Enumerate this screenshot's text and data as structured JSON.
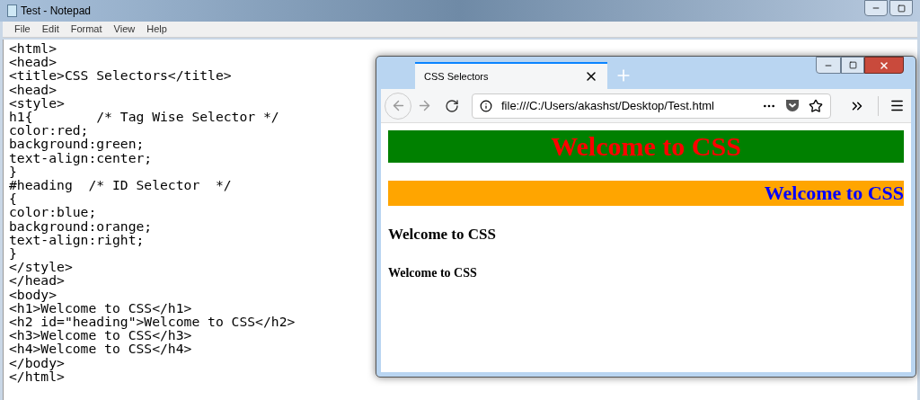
{
  "notepad": {
    "title": "Test - Notepad",
    "menu": [
      "File",
      "Edit",
      "Format",
      "View",
      "Help"
    ],
    "lines": [
      "<html>",
      "<head>",
      "<title>CSS Selectors</title>",
      "<head>",
      "<style>",
      "h1{        /* Tag Wise Selector */",
      "color:red;",
      "background:green;",
      "text-align:center;",
      "}",
      "#heading  /* ID Selector  */",
      "{",
      "color:blue;",
      "background:orange;",
      "text-align:right;",
      "}",
      "</style>",
      "</head>",
      "<body>",
      "<h1>Welcome to CSS</h1>",
      "<h2 id=\"heading\">Welcome to CSS</h2>",
      "<h3>Welcome to CSS</h3>",
      "<h4>Welcome to CSS</h4>",
      "</body>",
      "</html>"
    ]
  },
  "browser": {
    "tab": {
      "title": "CSS Selectors",
      "selected": true
    },
    "address": "file:///C:/Users/akashst/Desktop/Test.html",
    "headings": [
      {
        "kind": "h1",
        "text": "Welcome to CSS"
      },
      {
        "kind": "h2",
        "text": "Welcome to CSS"
      },
      {
        "kind": "h3",
        "text": "Welcome to CSS"
      },
      {
        "kind": "h4",
        "text": "Welcome to CSS"
      }
    ]
  }
}
